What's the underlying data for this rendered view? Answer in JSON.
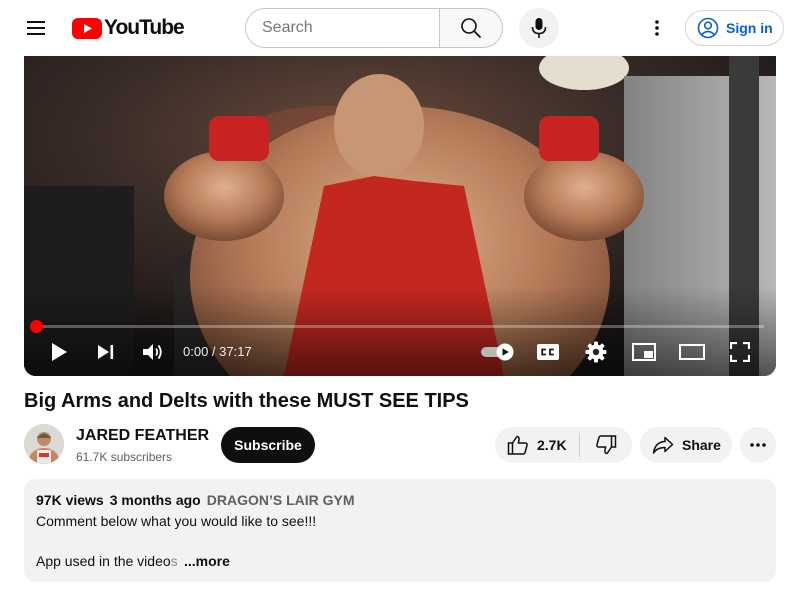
{
  "header": {
    "logo_text": "YouTube",
    "search": {
      "placeholder": "Search"
    },
    "sign_in_label": "Sign in",
    "accent_red": "#FF0000",
    "link_blue": "#065FD4",
    "icons": [
      "menu-icon",
      "youtube-logo-icon",
      "search-icon",
      "mic-icon",
      "more-vert-icon",
      "account-icon"
    ]
  },
  "player": {
    "current_time": "0:00",
    "duration": "37:17",
    "time_display": "0:00 / 37:17",
    "progress": 0,
    "autoplay_on": true,
    "icons": [
      "play-icon",
      "next-icon",
      "volume-icon",
      "autoplay-toggle",
      "captions-icon",
      "settings-icon",
      "miniplayer-icon",
      "theater-icon",
      "fullscreen-icon"
    ]
  },
  "video": {
    "title": "Big Arms and Delts with these MUST SEE TIPS",
    "channel": {
      "name": "JARED FEATHER",
      "subscribers": "61.7K subscribers"
    },
    "subscribe_label": "Subscribe",
    "likes": "2.7K",
    "share_label": "Share"
  },
  "description": {
    "views": "97K views",
    "date": "3 months ago",
    "location": "DRAGON’S LAIR GYM",
    "line1": "Comment below what you would like to see!!!",
    "line2_visible": "App used in the video",
    "line2_faded": "s",
    "more_label": "...more"
  }
}
